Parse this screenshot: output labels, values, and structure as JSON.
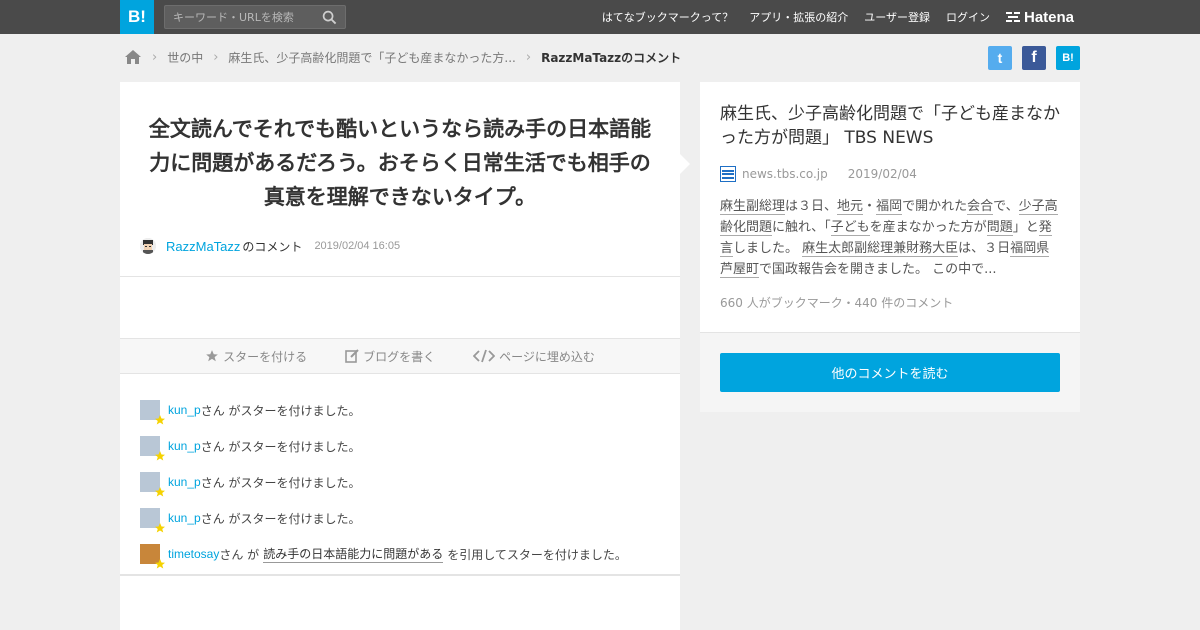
{
  "header": {
    "logo_text": "B!",
    "search_placeholder": "キーワード・URLを検索",
    "nav": [
      "はてなブックマークって？",
      "アプリ・拡張の紹介",
      "ユーザー登録",
      "ログイン"
    ],
    "brand": "Hatena"
  },
  "breadcrumb": {
    "items": [
      "世の中",
      "麻生氏、少子高齢化問題で「子ども産まなかった方..."
    ],
    "current": "RazzMaTazzのコメント"
  },
  "share": {
    "twitter": "t",
    "facebook": "f",
    "hatena": "B!"
  },
  "comment": {
    "text": "全文読んでそれでも酷いというなら読み手の日本語能力に問題があるだろう。おそらく日常生活でも相手の真意を理解できないタイプ。",
    "user": "RazzMaTazz",
    "user_suffix": "のコメント",
    "timestamp": "2019/02/04 16:05"
  },
  "actions": [
    "スターを付ける",
    "ブログを書く",
    "ページに埋め込む"
  ],
  "stars": [
    {
      "user": "kun_p",
      "text": "さん がスターを付けました。"
    },
    {
      "user": "kun_p",
      "text": "さん がスターを付けました。"
    },
    {
      "user": "kun_p",
      "text": "さん がスターを付けました。"
    },
    {
      "user": "kun_p",
      "text": "さん がスターを付けました。"
    },
    {
      "user": "timetosay",
      "text_before": "さん が",
      "quote": "読み手の日本語能力に問題がある",
      "text_after": "を引用してスターを付けました。"
    }
  ],
  "article": {
    "title": "麻生氏、少子高齢化問題で「子ども産まなかった方が問題」 TBS NEWS",
    "domain": "news.tbs.co.jp",
    "date": "2019/02/04",
    "summary": [
      {
        "t": "麻生副総理",
        "k": true
      },
      {
        "t": "は３日、",
        "k": false
      },
      {
        "t": "地元",
        "k": true
      },
      {
        "t": "・",
        "k": false
      },
      {
        "t": "福岡",
        "k": true
      },
      {
        "t": "で開かれた",
        "k": false
      },
      {
        "t": "会合",
        "k": true
      },
      {
        "t": "で、",
        "k": false
      },
      {
        "t": "少子高齢化問題",
        "k": true
      },
      {
        "t": "に触れ、「",
        "k": false
      },
      {
        "t": "子ども",
        "k": true
      },
      {
        "t": "を産まなかった方が",
        "k": false
      },
      {
        "t": "問題",
        "k": true
      },
      {
        "t": "」と",
        "k": false
      },
      {
        "t": "発言",
        "k": true
      },
      {
        "t": "しました。 ",
        "k": false
      },
      {
        "t": "麻生太郎副総理兼財務大臣",
        "k": true
      },
      {
        "t": "は、３日",
        "k": false
      },
      {
        "t": "福岡県芦屋町",
        "k": true
      },
      {
        "t": "で国政報告会を開きました。 この中で...",
        "k": false
      }
    ],
    "counts": "660 人がブックマーク・440 件のコメント",
    "read_button": "他のコメントを読む"
  }
}
